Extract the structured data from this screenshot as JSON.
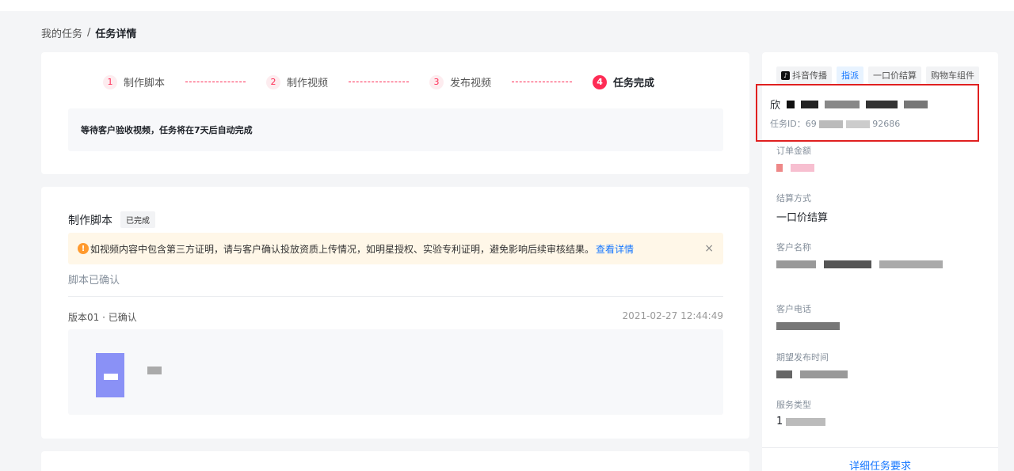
{
  "breadcrumb": {
    "parent": "我的任务",
    "separator": "/",
    "current": "任务详情"
  },
  "steps": [
    {
      "num": "1",
      "label": "制作脚本"
    },
    {
      "num": "2",
      "label": "制作视频"
    },
    {
      "num": "3",
      "label": "发布视频"
    },
    {
      "num": "4",
      "label": "任务完成"
    }
  ],
  "status_notice": "等待客户验收视频，任务将在7天后自动完成",
  "script_section": {
    "title": "制作脚本",
    "badge": "已完成",
    "warning": "如视频内容中包含第三方证明，请与客户确认投放资质上传情况，如明星授权、实验专利证明，避免影响后续审核结果。",
    "warning_link": "查看详情",
    "close": "×",
    "confirmed": "脚本已确认",
    "version": "版本01 · 已确认",
    "time": "2021-02-27 12:44:49"
  },
  "sidebar": {
    "tabs": [
      "抖音传播",
      "指派",
      "一口价结算",
      "购物车组件"
    ],
    "task_name": "欣",
    "task_id": "任务ID：69",
    "task_id_tail": "92686",
    "fields": [
      {
        "key": "订单金额",
        "value": ""
      },
      {
        "key": "结算方式",
        "value": "一口价结算"
      },
      {
        "key": "客户名称",
        "value": ""
      },
      {
        "key": "客户电话",
        "value": ""
      },
      {
        "key": "期望发布时间",
        "value": ""
      },
      {
        "key": "服务类型",
        "value": "1"
      }
    ],
    "detail_link": "详细任务要求"
  },
  "colors": {
    "accent": "#fe2c55",
    "link": "#1677ff",
    "highlight_border": "#e02020",
    "warning_bg": "#fff7e8"
  }
}
